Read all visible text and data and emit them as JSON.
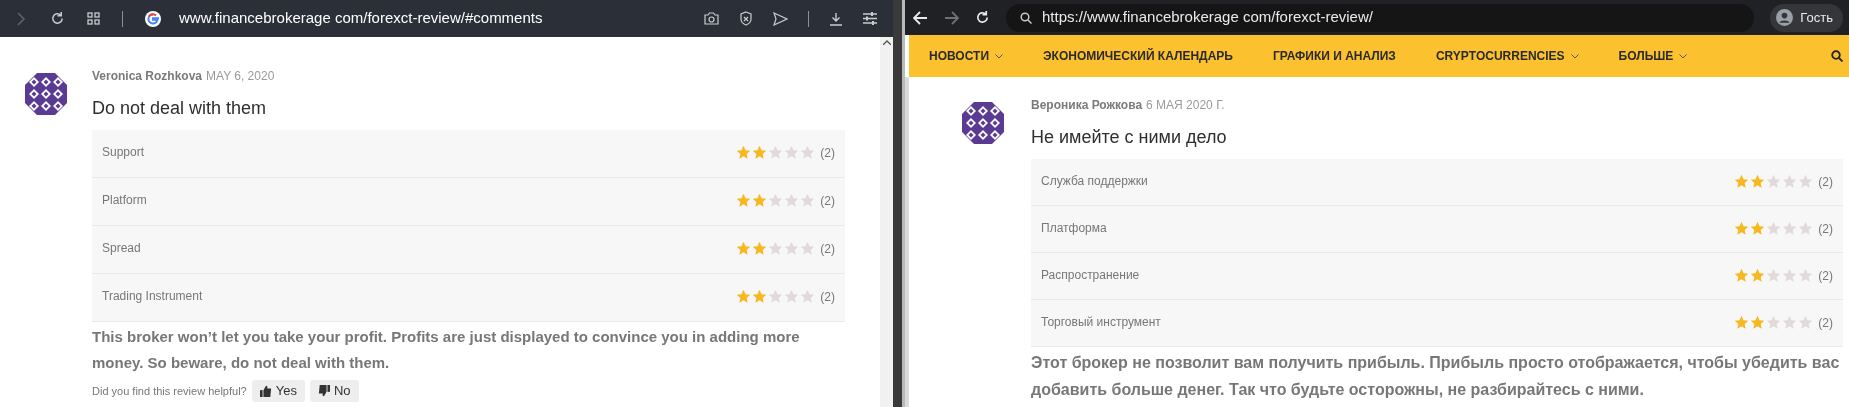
{
  "left_window": {
    "url": "www.financebrokerage com/forexct-review/#comments",
    "review": {
      "author": "Veronica Rozhkova",
      "date": "MAY 6, 2020",
      "title": "Do not deal with them",
      "ratings": [
        {
          "label": "Support",
          "stars": 2,
          "count": "(2)"
        },
        {
          "label": "Platform",
          "stars": 2,
          "count": "(2)"
        },
        {
          "label": "Spread",
          "stars": 2,
          "count": "(2)"
        },
        {
          "label": "Trading Instrument",
          "stars": 2,
          "count": "(2)"
        }
      ],
      "body": "This broker won’t let you take your profit. Profits are just displayed to convince you in adding more money. So beware, do not deal with them.",
      "helpful": {
        "question": "Did you find this review helpful?",
        "buttons": [
          {
            "label": "Yes",
            "kind": "up"
          },
          {
            "label": "No",
            "kind": "down"
          }
        ]
      }
    }
  },
  "right_window": {
    "url": "https://www.financebrokerage com/forexct-review/",
    "profile": "Гость",
    "nav": [
      {
        "label": "НОВОСТИ",
        "dropdown": true
      },
      {
        "label": "ЭКОНОМИЧЕСКИЙ КАЛЕНДАРЬ",
        "dropdown": false
      },
      {
        "label": "ГРАФИКИ И АНАЛИЗ",
        "dropdown": false
      },
      {
        "label": "CRYPTOCURRENCIES",
        "dropdown": true
      },
      {
        "label": "БОЛЬШЕ",
        "dropdown": true
      }
    ],
    "review": {
      "author": "Вероника Рожкова",
      "date": "6 МАЯ 2020 Г.",
      "title": "Не имейте с ними дело",
      "ratings": [
        {
          "label": "Служба поддержки",
          "stars": 2,
          "count": "(2)"
        },
        {
          "label": "Платформа",
          "stars": 2,
          "count": "(2)"
        },
        {
          "label": "Распространение",
          "stars": 2,
          "count": "(2)"
        },
        {
          "label": "Торговый инструмент",
          "stars": 2,
          "count": "(2)"
        }
      ],
      "body": "Этот брокер не позволит вам получить прибыль. Прибыль просто отображается, чтобы убедить вас добавить больше денег. Так что будьте осторожны, не разбирайтесь с ними."
    }
  }
}
